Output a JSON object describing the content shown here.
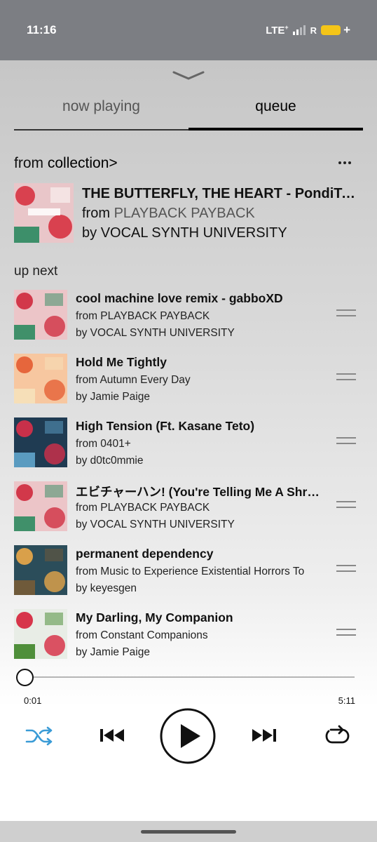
{
  "status_bar": {
    "time": "11:16",
    "network": "LTE",
    "network_sup": "+",
    "roaming": "R",
    "battery_color": "#f5c518"
  },
  "tabs": [
    {
      "label": "now playing",
      "active": false
    },
    {
      "label": "queue",
      "active": true
    }
  ],
  "source": {
    "prefix": "from ",
    "name": "collection",
    "chevron": ">"
  },
  "now_playing": {
    "title": "THE BUTTERFLY, THE HEART - PondiTones",
    "album_prefix": "from ",
    "album": "PLAYBACK PAYBACK",
    "artist_prefix": "by ",
    "artist": "VOCAL SYNTH UNIVERSITY",
    "art_colors": [
      "#e9c6c9",
      "#d9414f",
      "#3d8f6a"
    ]
  },
  "up_next_label": "up next",
  "queue": [
    {
      "title": "cool machine love remix - gabboXD",
      "album": "from PLAYBACK PAYBACK",
      "artist": "by VOCAL SYNTH UNIVERSITY",
      "art_colors": [
        "#ecc5c8",
        "#d2384a",
        "#40906a"
      ]
    },
    {
      "title": "Hold Me Tightly",
      "album": "from Autumn Every Day",
      "artist": "by Jamie Paige",
      "art_colors": [
        "#f7c7a0",
        "#e6663c",
        "#f6dfb8"
      ]
    },
    {
      "title": "High Tension (Ft. Kasane Teto)",
      "album": "from 0401+",
      "artist": "by d0tc0mmie",
      "art_colors": [
        "#1f3b52",
        "#c8304a",
        "#5a9bc0"
      ]
    },
    {
      "title": "エビチャーハン! (You're Telling Me A Shrimp Fried This Rice?)",
      "album": "from PLAYBACK PAYBACK",
      "artist": "by VOCAL SYNTH UNIVERSITY",
      "art_colors": [
        "#ecc5c8",
        "#d2384a",
        "#40906a"
      ]
    },
    {
      "title": "permanent dependency",
      "album": "from Music to Experience Existential Horrors To",
      "artist": "by keyesgen",
      "art_colors": [
        "#2b4d5a",
        "#d9a04a",
        "#6f5a3a"
      ]
    },
    {
      "title": "My Darling, My Companion",
      "album": "from Constant Companions",
      "artist": "by Jamie Paige",
      "art_colors": [
        "#e8ede6",
        "#d7354a",
        "#4f8f3a"
      ]
    }
  ],
  "player": {
    "elapsed": "0:01",
    "duration": "5:11",
    "progress_fraction": 0.003,
    "shuffle_color": "#3a9bd6",
    "icons": [
      "shuffle-icon",
      "previous-icon",
      "play-icon",
      "next-icon",
      "repeat-icon"
    ]
  }
}
